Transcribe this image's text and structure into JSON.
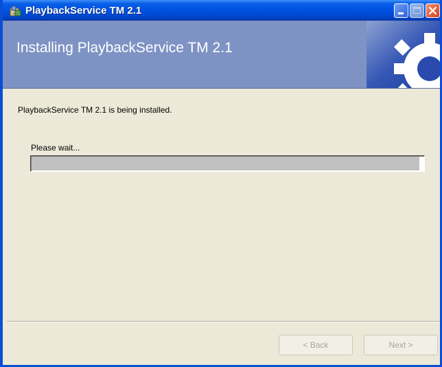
{
  "window": {
    "title": "PlaybackService TM 2.1",
    "icon": "installer-icon"
  },
  "banner": {
    "title": "Installing PlaybackService TM 2.1",
    "graphic": "gear-icon"
  },
  "content": {
    "status_text": "PlaybackService TM 2.1 is being installed.",
    "wait_label": "Please wait...",
    "progress_fraction": 0.99
  },
  "buttons": {
    "back_label": "< Back",
    "next_label": "Next >",
    "back_enabled": false,
    "next_enabled": false
  },
  "colors": {
    "titlebar": "#0054e3",
    "banner": "#7e93c4",
    "dialog_bg": "#ece9d8",
    "progress_fill": "#c0c0c0",
    "disabled_text": "#a7a69c"
  }
}
